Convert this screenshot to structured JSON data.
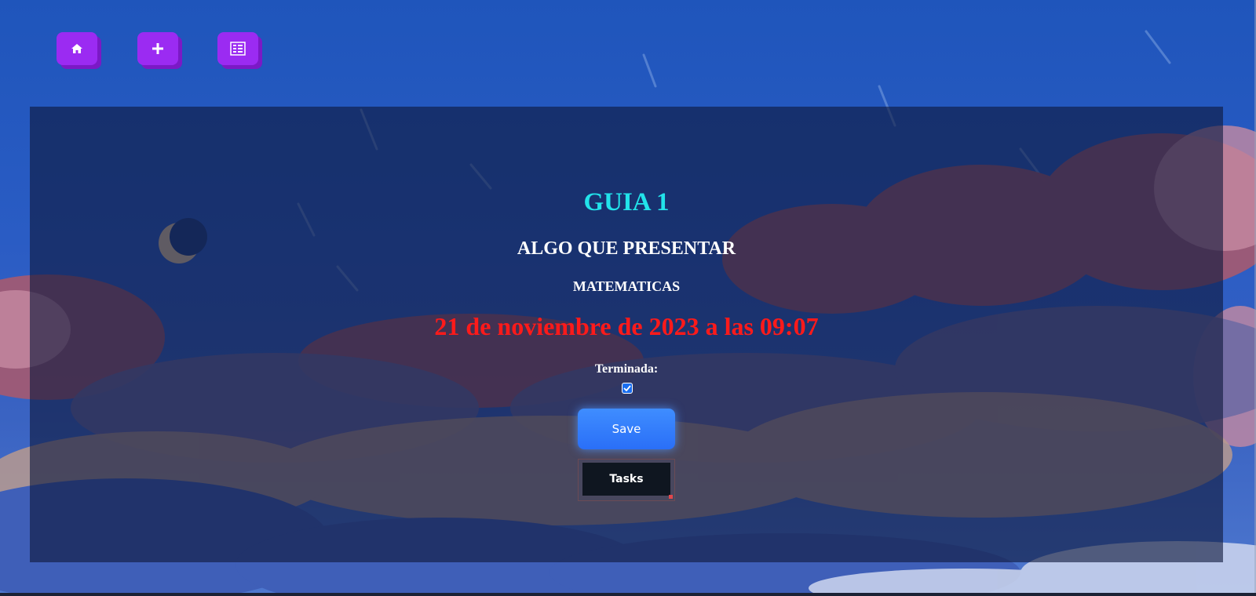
{
  "nav": {
    "home_icon": "home-icon",
    "add_icon": "plus-icon",
    "list_icon": "task-list-icon"
  },
  "task": {
    "title": "GUIA 1",
    "description": "ALGO QUE PRESENTAR",
    "subject": "MATEMATICAS",
    "due_date": "21 de noviembre de 2023 a las 09:07",
    "done_label": "Terminada:",
    "done_checked": true
  },
  "actions": {
    "save_label": "Save",
    "tasks_label": "Tasks"
  },
  "colors": {
    "nav_button": "#9b2bf2",
    "title": "#22e3ea",
    "due_date": "#ff1a1a",
    "save_button": "#2a6ff7",
    "tasks_button": "#0f1620"
  }
}
